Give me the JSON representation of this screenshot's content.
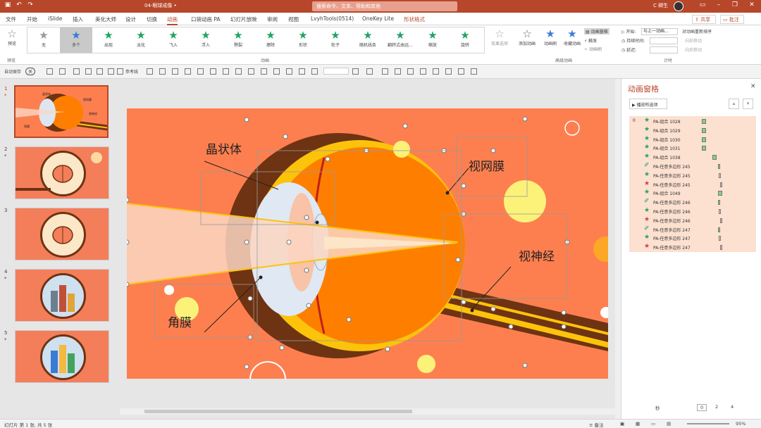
{
  "titlebar": {
    "filename": "04-眼球成像 •",
    "search": "搜索命令、文本、帮助和其他",
    "user": "C 卿生"
  },
  "menu": [
    "文件",
    "开始",
    "iSlide",
    "插入",
    "美化大师",
    "设计",
    "切换",
    "动画",
    "口袋动画 PA",
    "幻灯片放映",
    "审阅",
    "视图",
    "LvyhTools(0514)",
    "OneKey Lite",
    "形状格式"
  ],
  "active_tab": "动画",
  "share": "共享",
  "comments": "批注",
  "ribbon": {
    "preview": "预览",
    "preview_group": "预览",
    "gallery": [
      "无",
      "多个",
      "出现",
      "淡化",
      "飞入",
      "浮入",
      "劈裂",
      "擦除",
      "形状",
      "轮子",
      "随机线条",
      "翻转式由远...",
      "缩放",
      "旋转"
    ],
    "gallery_selected": "多个",
    "effect_options": "效果选项",
    "anim_group": "动画",
    "add_animation": "添加动画",
    "anim_painter": "动画刷",
    "brush": "收藏动画",
    "anim_pane": "动画窗格",
    "trigger": "触发",
    "painter2": "动画刷",
    "adv_group": "高级动画",
    "start_label": "开始:",
    "start_value": "与上一动画...",
    "duration_label": "持续时间:",
    "delay_label": "延迟:",
    "reorder": "对动画重新排序",
    "move_earlier": "向前移动",
    "move_later": "向后移动",
    "timing_group": "计时"
  },
  "qat": {
    "autosave": "自动保存",
    "autosave_state": "关",
    "guides": "参考线"
  },
  "slides": [
    {
      "num": "1",
      "star": "*"
    },
    {
      "num": "2",
      "star": "*"
    },
    {
      "num": "3",
      "star": ""
    },
    {
      "num": "4",
      "star": "*"
    },
    {
      "num": "5",
      "star": "*"
    }
  ],
  "slide_labels": {
    "lens": "晶状体",
    "retina": "视网膜",
    "optic_nerve": "视神经",
    "cornea": "角膜"
  },
  "thumb1_labels": {
    "a": "晶状体",
    "b": "视网膜",
    "c": "视神经",
    "d": "角膜"
  },
  "pane": {
    "title": "动画窗格",
    "play_all": "播放所选项",
    "items": [
      {
        "index": "0",
        "name": "PA-组合 1028",
        "icon": "star",
        "bar": "green"
      },
      {
        "index": "",
        "name": "PA-组合 1029",
        "icon": "star",
        "bar": "green"
      },
      {
        "index": "",
        "name": "PA-组合 1030",
        "icon": "star",
        "bar": "green"
      },
      {
        "index": "",
        "name": "PA-组合 1031",
        "icon": "star",
        "bar": "green"
      },
      {
        "index": "",
        "name": "PA-组合 1038",
        "icon": "star",
        "bar": "green"
      },
      {
        "index": "",
        "name": "PA-任意多边形 245",
        "icon": "path",
        "bar": "green"
      },
      {
        "index": "",
        "name": "PA-任意多边形 245",
        "icon": "star",
        "bar": "yellow"
      },
      {
        "index": "",
        "name": "PA-任意多边形 245",
        "icon": "red",
        "bar": "pink"
      },
      {
        "index": "",
        "name": "PA-组合 1049",
        "icon": "star",
        "bar": "green"
      },
      {
        "index": "",
        "name": "PA-任意多边形 246",
        "icon": "path",
        "bar": "green"
      },
      {
        "index": "",
        "name": "PA-任意多边形 246",
        "icon": "star",
        "bar": "yellow"
      },
      {
        "index": "",
        "name": "PA-任意多边形 246",
        "icon": "red",
        "bar": "pink"
      },
      {
        "index": "",
        "name": "PA-任意多边形 247",
        "icon": "path",
        "bar": "green"
      },
      {
        "index": "",
        "name": "PA-任意多边形 247",
        "icon": "star",
        "bar": "yellow"
      },
      {
        "index": "",
        "name": "PA-任意多边形 247",
        "icon": "red",
        "bar": "pink"
      }
    ],
    "seconds": "秒",
    "timeline": [
      "0",
      "2",
      "4"
    ]
  },
  "status": {
    "slide_info": "幻灯片 第 1 张, 共 5 张",
    "notes": "备注",
    "zoom": "95%"
  },
  "colors": {
    "accent": "#b7472a",
    "slide_bg": "#fd7f4f",
    "eye_orange": "#fe7f00",
    "brown": "#6e3312",
    "yellow": "#fcc30b"
  }
}
